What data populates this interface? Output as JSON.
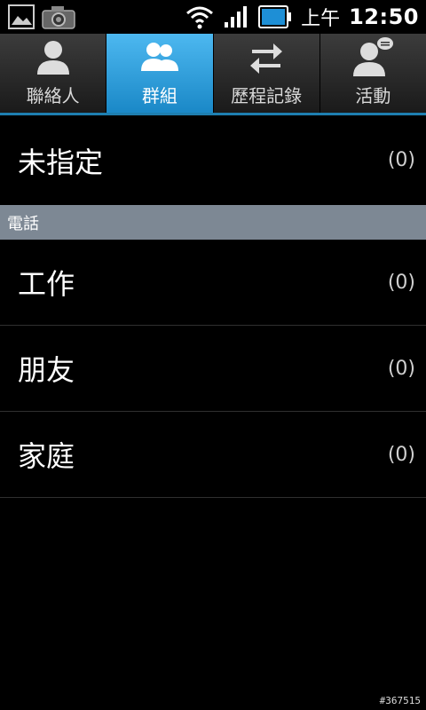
{
  "status_bar": {
    "time_ampm": "上午",
    "time": "12:50",
    "icons": [
      "gallery-icon",
      "camera-icon",
      "wifi-icon",
      "signal-icon",
      "battery-icon"
    ],
    "battery_color": "#1e8fd6"
  },
  "tabs": [
    {
      "label": "聯絡人",
      "icon": "person-icon",
      "active": false
    },
    {
      "label": "群組",
      "icon": "group-icon",
      "active": true
    },
    {
      "label": "歷程記錄",
      "icon": "swap-arrows-icon",
      "active": false
    },
    {
      "label": "活動",
      "icon": "person-chat-icon",
      "active": false
    }
  ],
  "groups": {
    "unassigned": {
      "name": "未指定",
      "count": "(0)"
    },
    "section_phone": "電話",
    "items": [
      {
        "name": "工作",
        "count": "(0)"
      },
      {
        "name": "朋友",
        "count": "(0)"
      },
      {
        "name": "家庭",
        "count": "(0)"
      }
    ]
  },
  "colors": {
    "accent": "#1e7fb0",
    "section_bg": "#7d8894"
  },
  "watermark": "#367515"
}
